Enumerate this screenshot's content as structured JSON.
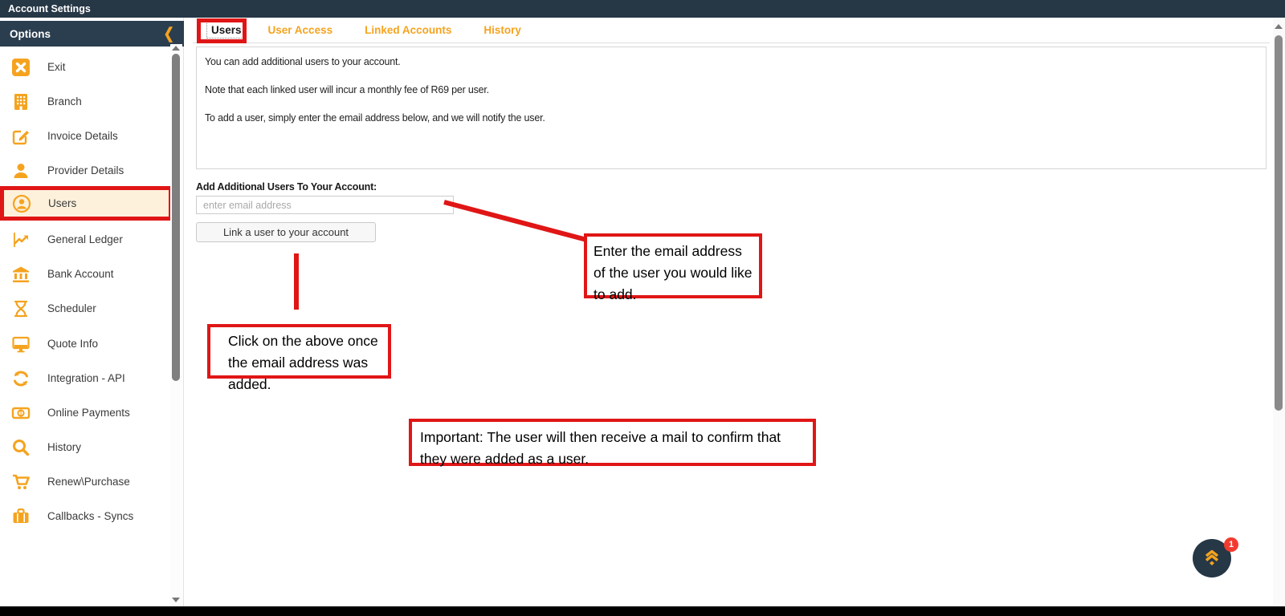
{
  "colors": {
    "accent": "#F5A31F",
    "dark": "#263746",
    "annotation_red": "#E01616",
    "badge_red": "#F23B2F"
  },
  "top_bar": {
    "title": "Account Settings"
  },
  "sidebar": {
    "header": {
      "title": "Options",
      "collapse_icon": "❮"
    },
    "items": [
      {
        "label": "Exit",
        "icon": "exit-icon"
      },
      {
        "label": "Branch",
        "icon": "branch-icon"
      },
      {
        "label": "Invoice Details",
        "icon": "invoice-details-icon"
      },
      {
        "label": "Provider Details",
        "icon": "provider-details-icon"
      },
      {
        "label": "Users",
        "icon": "users-icon",
        "active": true
      },
      {
        "label": "General Ledger",
        "icon": "general-ledger-icon"
      },
      {
        "label": "Bank Account",
        "icon": "bank-account-icon"
      },
      {
        "label": "Scheduler",
        "icon": "scheduler-icon"
      },
      {
        "label": "Quote Info",
        "icon": "quote-info-icon"
      },
      {
        "label": "Integration - API",
        "icon": "integration-api-icon"
      },
      {
        "label": "Online Payments",
        "icon": "online-payments-icon"
      },
      {
        "label": "History",
        "icon": "history-icon"
      },
      {
        "label": "Renew\\Purchase",
        "icon": "renew-purchase-icon"
      },
      {
        "label": "Callbacks - Syncs",
        "icon": "callbacks-syncs-icon"
      }
    ]
  },
  "main": {
    "tabs": [
      {
        "label": "Users",
        "active": true
      },
      {
        "label": "User Access"
      },
      {
        "label": "Linked Accounts"
      },
      {
        "label": "History"
      }
    ],
    "info_paragraphs": {
      "p1": "You can add additional users to your account.",
      "p2": "Note that each linked user will incur a monthly fee of R69 per user.",
      "p3": "To add a user, simply enter the email address below, and we will notify the user."
    },
    "form": {
      "label": "Add Additional Users To Your Account:",
      "email_placeholder": "enter email address",
      "link_button_label": "Link a user to your account"
    }
  },
  "annotations": {
    "email_note": "Enter the email address of the user you would like to add.",
    "click_note": "Click on the above once the email address was added.",
    "important_note": "Important: The user will then receive a mail to confirm that they were added as a user."
  },
  "widget": {
    "badge_count": "1"
  }
}
